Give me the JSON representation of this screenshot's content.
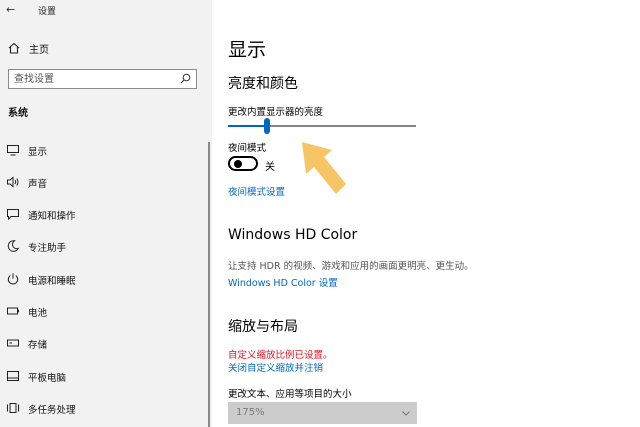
{
  "window": {
    "title": "设置",
    "back_glyph": "←"
  },
  "sidebar": {
    "home_label": "主页",
    "search_placeholder": "查找设置",
    "section_title": "系统",
    "items": [
      {
        "label": "显示",
        "icon": "monitor-icon"
      },
      {
        "label": "声音",
        "icon": "speaker-icon"
      },
      {
        "label": "通知和操作",
        "icon": "notification-icon"
      },
      {
        "label": "专注助手",
        "icon": "moon-icon"
      },
      {
        "label": "电源和睡眠",
        "icon": "power-icon"
      },
      {
        "label": "电池",
        "icon": "battery-icon"
      },
      {
        "label": "存储",
        "icon": "storage-icon"
      },
      {
        "label": "平板电脑",
        "icon": "tablet-icon"
      },
      {
        "label": "多任务处理",
        "icon": "multitask-icon"
      }
    ]
  },
  "main": {
    "page_title": "显示",
    "brightness": {
      "heading": "亮度和颜色",
      "slider_label": "更改内置显示器的亮度",
      "slider_fraction": 0.21
    },
    "night_mode": {
      "label": "夜间模式",
      "state": "关",
      "settings_link": "夜间模式设置"
    },
    "hdr": {
      "heading": "Windows HD Color",
      "description": "让支持 HDR 的视频、游戏和应用的画面更明亮、更生动。",
      "settings_link": "Windows HD Color 设置"
    },
    "scale": {
      "heading": "缩放与布局",
      "warning": "自定义缩放比例已设置。",
      "sign_out_link": "关闭自定义缩放并注销",
      "size_label": "更改文本、应用等项目的大小",
      "size_value": "175%"
    }
  },
  "colors": {
    "accent": "#0067c0",
    "sidebar_bg": "#f2f2f2",
    "warning": "#e81123",
    "arrow": "#f7c566"
  }
}
